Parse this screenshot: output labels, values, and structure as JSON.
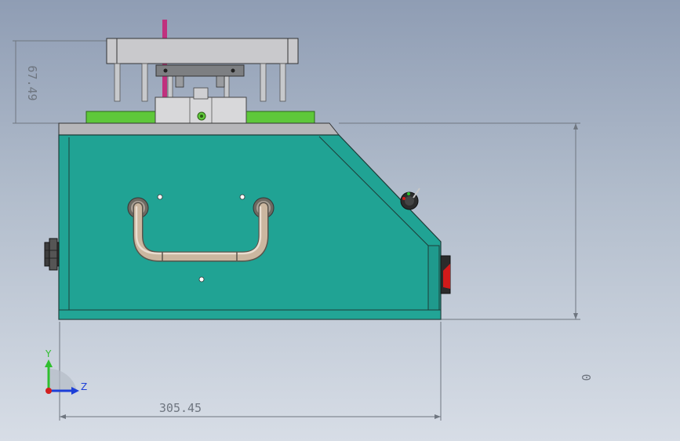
{
  "dimensions": {
    "top_height": "67.49",
    "width": "305.45",
    "origin": "0"
  },
  "triad": {
    "y_label": "Y",
    "z_label": "Z",
    "y_color": "#2fbf2f",
    "z_color": "#1d3fd8",
    "x_color": "#d21f1f"
  },
  "colors": {
    "body": "#20a394",
    "top_plate": "#c8c8c8",
    "green_plate": "#5ec83a",
    "rod": "#c0317e",
    "handle": "#c8b39a",
    "switch": "#d11a1a"
  }
}
